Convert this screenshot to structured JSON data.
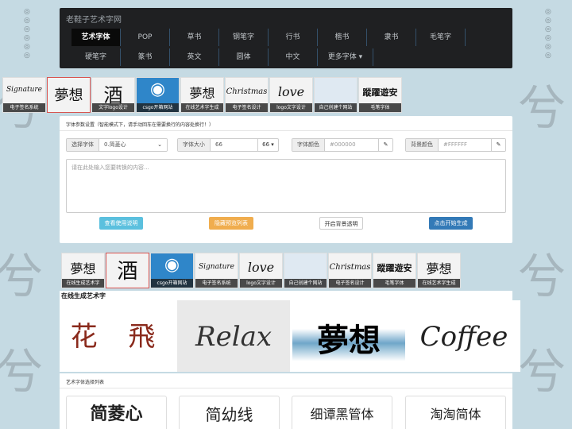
{
  "site": {
    "brand": "老鞋子艺术字网"
  },
  "nav": {
    "row1": [
      "艺术字体",
      "POP",
      "草书",
      "钢笔字",
      "行书",
      "楷书",
      "隶书",
      "毛笔字"
    ],
    "row2": [
      "硬笔字",
      "篆书",
      "英文",
      "圆体",
      "中文",
      "更多字体 ▾"
    ],
    "active": "艺术字体"
  },
  "thumbs_top": [
    {
      "label": "电子签名系统",
      "art": "Signature"
    },
    {
      "label": "",
      "art": "夢想"
    },
    {
      "label": "文字logo设计",
      "art": "酒"
    },
    {
      "label": "csgo开箱网站",
      "art": "◉"
    },
    {
      "label": "在线艺术字生成",
      "art": "夢想"
    },
    {
      "label": "电子签名设计",
      "art": "Christmas"
    },
    {
      "label": "logo文字设计",
      "art": "love"
    },
    {
      "label": "自己创建个网站",
      "art": ""
    },
    {
      "label": "毛笔字体",
      "art": "蹤躍遊安"
    }
  ],
  "settings": {
    "hint": "字体参数设置（智能模式下，请手动回车在需要换行的内容处换行！）",
    "font_label": "选择字体",
    "font_value": "0.简菱心",
    "size_label": "字体大小",
    "size_value": "66",
    "size_select": "66 ▾",
    "color_label": "字体颜色",
    "color_placeholder": "#000000",
    "bg_label": "背景颜色",
    "bg_placeholder": "#FFFFFF",
    "textarea_placeholder": "请在此处输入您要转换的内容...",
    "btn_help": "查看使用说明",
    "btn_preview": "隐藏预览列表",
    "btn_transparent": "开启背景透明",
    "btn_generate": "点击开始生成"
  },
  "thumbs_mid": [
    {
      "label": "在线生成艺术字",
      "art": "夢想"
    },
    {
      "label": "",
      "art": "酒"
    },
    {
      "label": "csgo开箱网站",
      "art": "◉"
    },
    {
      "label": "电子签名系统",
      "art": "Signature"
    },
    {
      "label": "logo文字设计",
      "art": "love"
    },
    {
      "label": "自己创建个网站",
      "art": ""
    },
    {
      "label": "电子签名设计",
      "art": "Christmas"
    },
    {
      "label": "毛笔字体",
      "art": "蹤躍遊安"
    },
    {
      "label": "在线艺术字生成",
      "art": "夢想"
    }
  ],
  "showcase": {
    "title": "在线生成艺术字",
    "items": [
      "花 飛",
      "Relax",
      "夢想",
      "Coffee"
    ]
  },
  "font_list": {
    "title": "艺术字体选择列表",
    "cards": [
      "简菱心",
      "简幼线",
      "细谭黑管体",
      "淘淘简体"
    ]
  },
  "colors": {
    "nav_bg": "#1f2022",
    "primary": "#337ab7",
    "info": "#5bc0de",
    "warning": "#f0ad4e"
  }
}
